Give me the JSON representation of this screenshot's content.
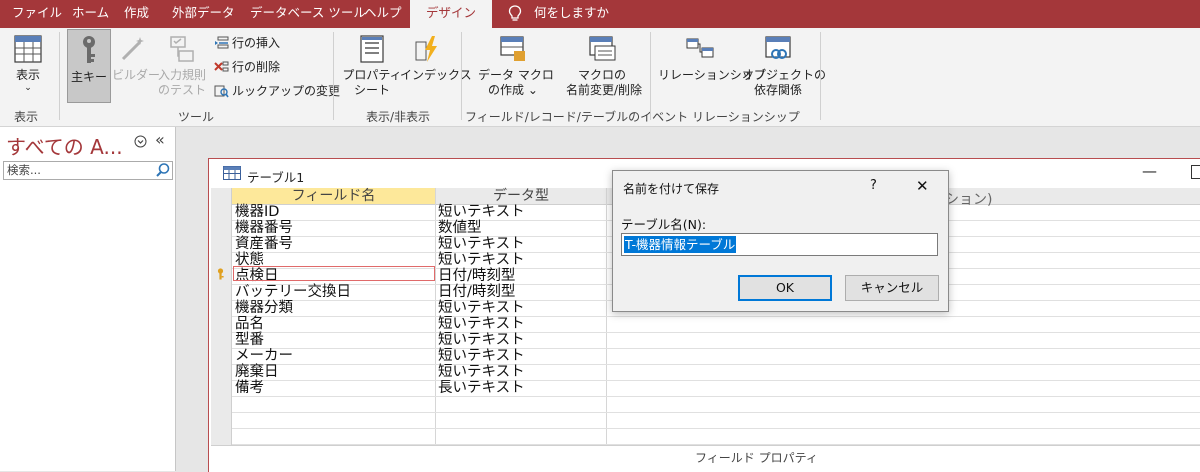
{
  "tabs": [
    {
      "label": "ファイル"
    },
    {
      "label": "ホーム"
    },
    {
      "label": "作成"
    },
    {
      "label": "外部データ"
    },
    {
      "label": "データベース ツール"
    },
    {
      "label": "ヘルプ"
    },
    {
      "label": "デザイン"
    },
    {
      "label": "何をしますか"
    }
  ],
  "ribbon": {
    "view": {
      "label": "表示",
      "group": "表示"
    },
    "tools": {
      "primary_key": "主キー",
      "builder": "ビルダー",
      "validation_line1": "入力規則",
      "validation_line2": "のテスト",
      "insert_rows": "行の挿入",
      "delete_rows": "行の削除",
      "lookup": "ルックアップの変更",
      "group": "ツール"
    },
    "showhide": {
      "property_line1": "プロパティ",
      "property_line2": "シート",
      "indexes": "インデックス",
      "group": "表示/非表示"
    },
    "events": {
      "data_macro_line1": "データ マクロ",
      "data_macro_line2": "の作成",
      "rename_macro_line1": "マクロの",
      "rename_macro_line2": "名前変更/削除",
      "group": "フィールド/レコード/テーブルのイベント"
    },
    "relationships": {
      "relationships": "リレーションシップ",
      "deps_line1": "オブジェクトの",
      "deps_line2": "依存関係",
      "group": "リレーションシップ"
    }
  },
  "nav": {
    "title": "すべての A...",
    "search_placeholder": "検索..."
  },
  "table": {
    "title": "テーブル1",
    "headers": [
      "フィールド名",
      "データ型"
    ],
    "hidden_header_fragment": "ション)",
    "rows": [
      {
        "name": "機器ID",
        "type": "短いテキスト"
      },
      {
        "name": "機器番号",
        "type": "数値型"
      },
      {
        "name": "資産番号",
        "type": "短いテキスト"
      },
      {
        "name": "状態",
        "type": "短いテキスト"
      },
      {
        "name": "点検日",
        "type": "日付/時刻型"
      },
      {
        "name": "バッテリー交換日",
        "type": "日付/時刻型"
      },
      {
        "name": "機器分類",
        "type": "短いテキスト"
      },
      {
        "name": "品名",
        "type": "短いテキスト"
      },
      {
        "name": "型番",
        "type": "短いテキスト"
      },
      {
        "name": "メーカー",
        "type": "短いテキスト"
      },
      {
        "name": "廃棄日",
        "type": "短いテキスト"
      },
      {
        "name": "備考",
        "type": "長いテキスト"
      }
    ],
    "field_properties": "フィールド プロパティ"
  },
  "dialog": {
    "title": "名前を付けて保存",
    "help": "?",
    "label": "テーブル名(N):",
    "value": "T-機器情報テーブル",
    "ok": "OK",
    "cancel": "キャンセル"
  },
  "colors": {
    "accent": "#a4373a",
    "selected_header": "#fde89a",
    "selection": "#0078d7"
  }
}
